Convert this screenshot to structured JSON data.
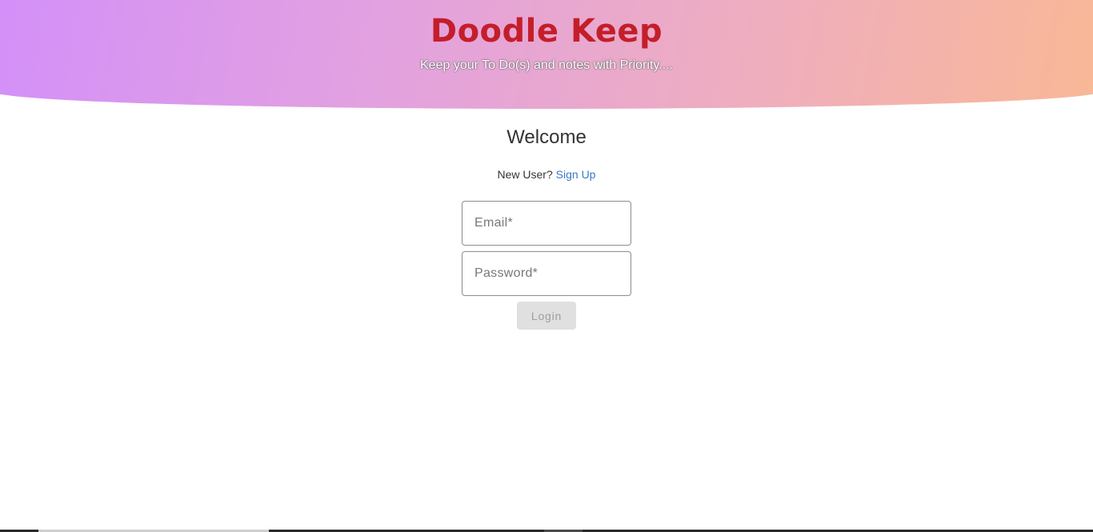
{
  "header": {
    "brand": "Doodle Keep",
    "tagline": "Keep your To Do(s) and notes with Priority....",
    "gradient_colors": [
      "#d38ff9",
      "#f9b895"
    ],
    "brand_color": "#c41e2a"
  },
  "login": {
    "welcome": "Welcome",
    "new_user_text": "New User?",
    "signup_link": "Sign Up",
    "email_placeholder": "Email*",
    "email_value": "",
    "password_placeholder": "Password*",
    "password_value": "",
    "login_button": "Login",
    "link_color": "#3a77c9"
  }
}
